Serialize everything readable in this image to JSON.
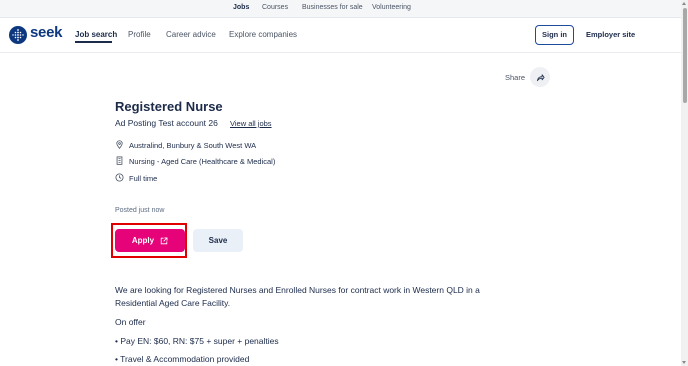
{
  "topbar": {
    "links": [
      {
        "label": "Jobs",
        "active": true
      },
      {
        "label": "Courses"
      },
      {
        "label": "Businesses for sale"
      },
      {
        "label": "Volunteering"
      }
    ]
  },
  "header": {
    "logo_text": "seek",
    "nav": [
      {
        "label": "Job search",
        "active": true
      },
      {
        "label": "Profile"
      },
      {
        "label": "Career advice"
      },
      {
        "label": "Explore companies"
      }
    ],
    "sign_in": "Sign in",
    "employer_site": "Employer site"
  },
  "share": {
    "label": "Share",
    "icon": "share-icon"
  },
  "job": {
    "title": "Registered Nurse",
    "advertiser": "Ad Posting Test account 26",
    "view_all": "View all jobs",
    "location": "Australind, Bunbury & South West WA",
    "category": "Nursing - Aged Care (Healthcare & Medical)",
    "work_type": "Full time",
    "posted": "Posted just now",
    "apply_label": "Apply",
    "save_label": "Save"
  },
  "description": {
    "intro": "We are looking for Registered Nurses and Enrolled Nurses for contract work in Western QLD in a Residential Aged Care Facility.",
    "on_offer_heading": "On offer",
    "bullets": [
      "• Pay EN: $60, RN: $75 + super + penalties",
      "• Travel & Accommodation provided"
    ]
  },
  "colors": {
    "brand_navy": "#1c2b4a",
    "apply_pink": "#e60278",
    "highlight_red": "#e00000",
    "save_bg": "#eaf0f8"
  }
}
